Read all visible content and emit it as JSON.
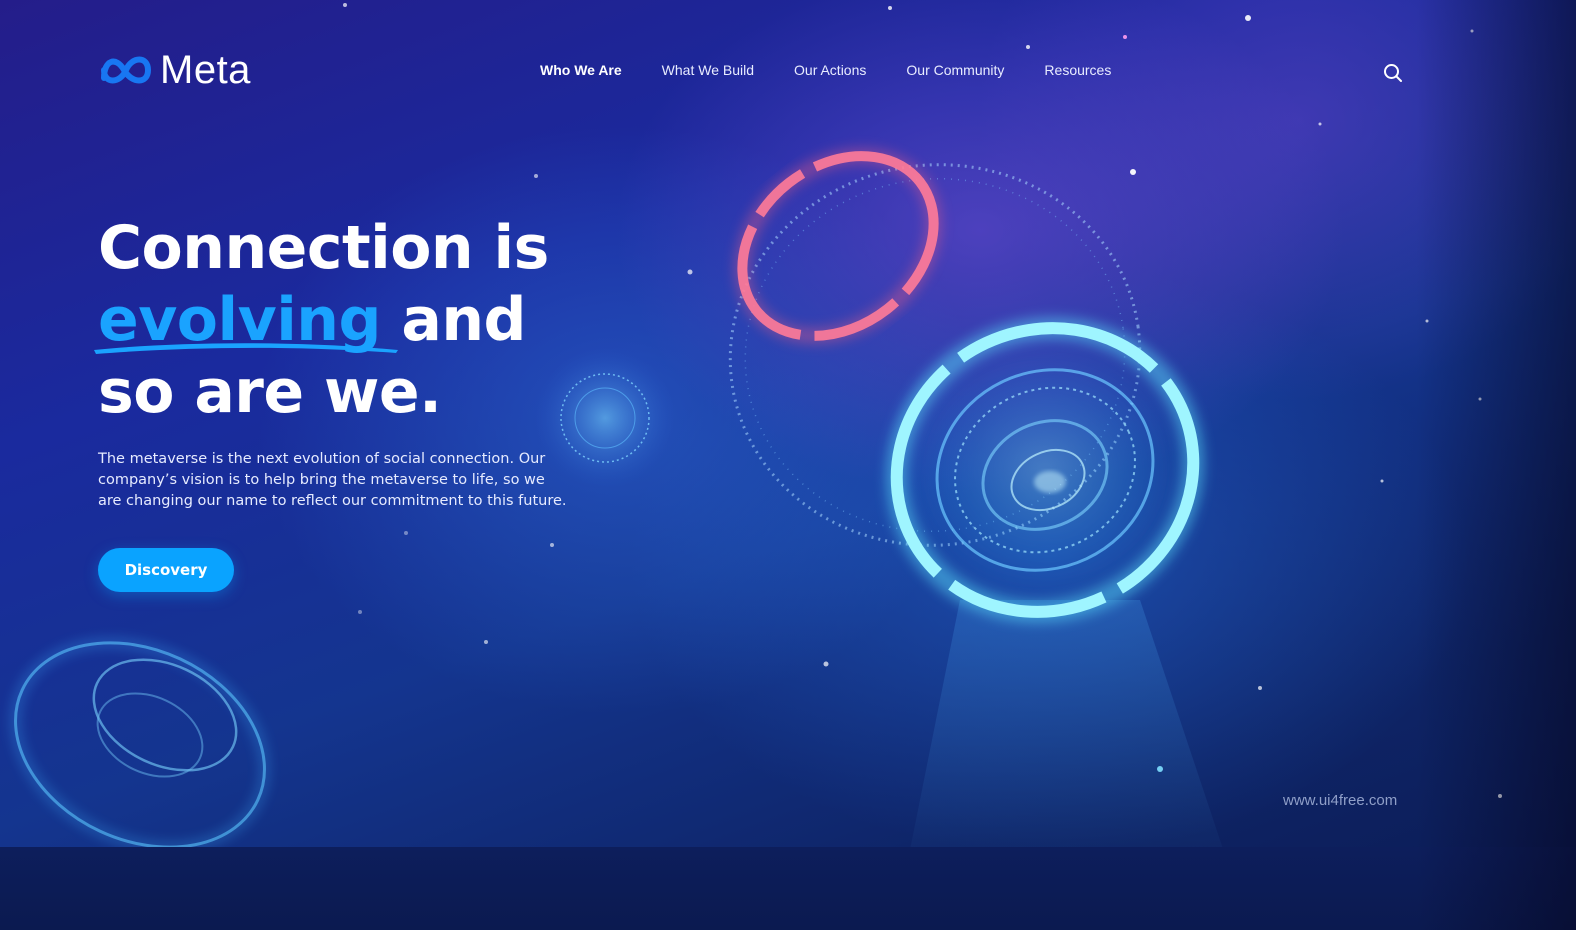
{
  "brand": {
    "name": "Meta",
    "logo_icon": "meta-infinity-icon",
    "logo_color": "#1877f2"
  },
  "nav": {
    "items": [
      {
        "label": "Who We Are",
        "active": true
      },
      {
        "label": "What We Build",
        "active": false
      },
      {
        "label": "Our Actions",
        "active": false
      },
      {
        "label": "Our Community",
        "active": false
      },
      {
        "label": "Resources",
        "active": false
      }
    ],
    "search_icon": "search-icon"
  },
  "hero": {
    "title_line1": "Connection is",
    "title_highlight": "evolving",
    "title_line2_rest": " and",
    "title_line3": "so are we.",
    "description": "The metaverse is the next evolution of social connection. Our company’s vision is to help bring the metaverse to life, so we are changing our name to reflect our commitment to this future.",
    "cta_label": "Discovery"
  },
  "watermark": "www.ui4free.com",
  "colors": {
    "accent": "#0aa3ff",
    "highlight_text": "#1aa3ff",
    "background_deep": "#0b1a52",
    "ring_red": "#ff6b8a",
    "ring_cyan": "#5fe4ff"
  }
}
